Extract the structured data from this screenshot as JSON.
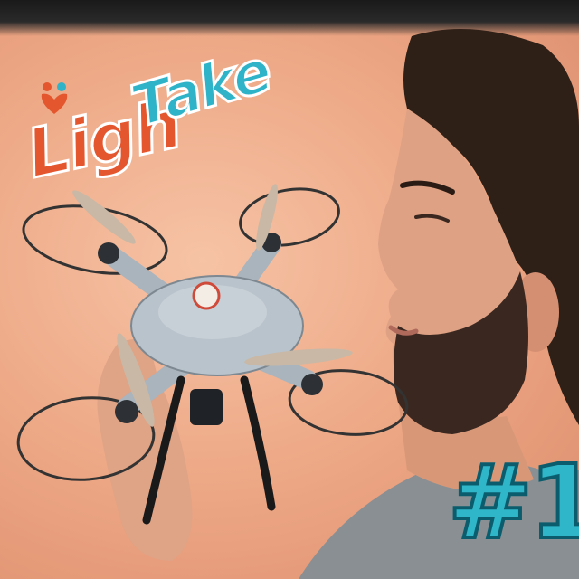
{
  "logo": {
    "part1": "Ligh",
    "part2": "Take"
  },
  "badge": {
    "text": "#1"
  },
  "colors": {
    "logo_orange": "#e4572e",
    "logo_teal": "#2fb3c8",
    "badge_teal": "#2fb7c9",
    "background": "#eeaa88"
  },
  "icons": {
    "logo_mark": "people-heart-icon"
  }
}
